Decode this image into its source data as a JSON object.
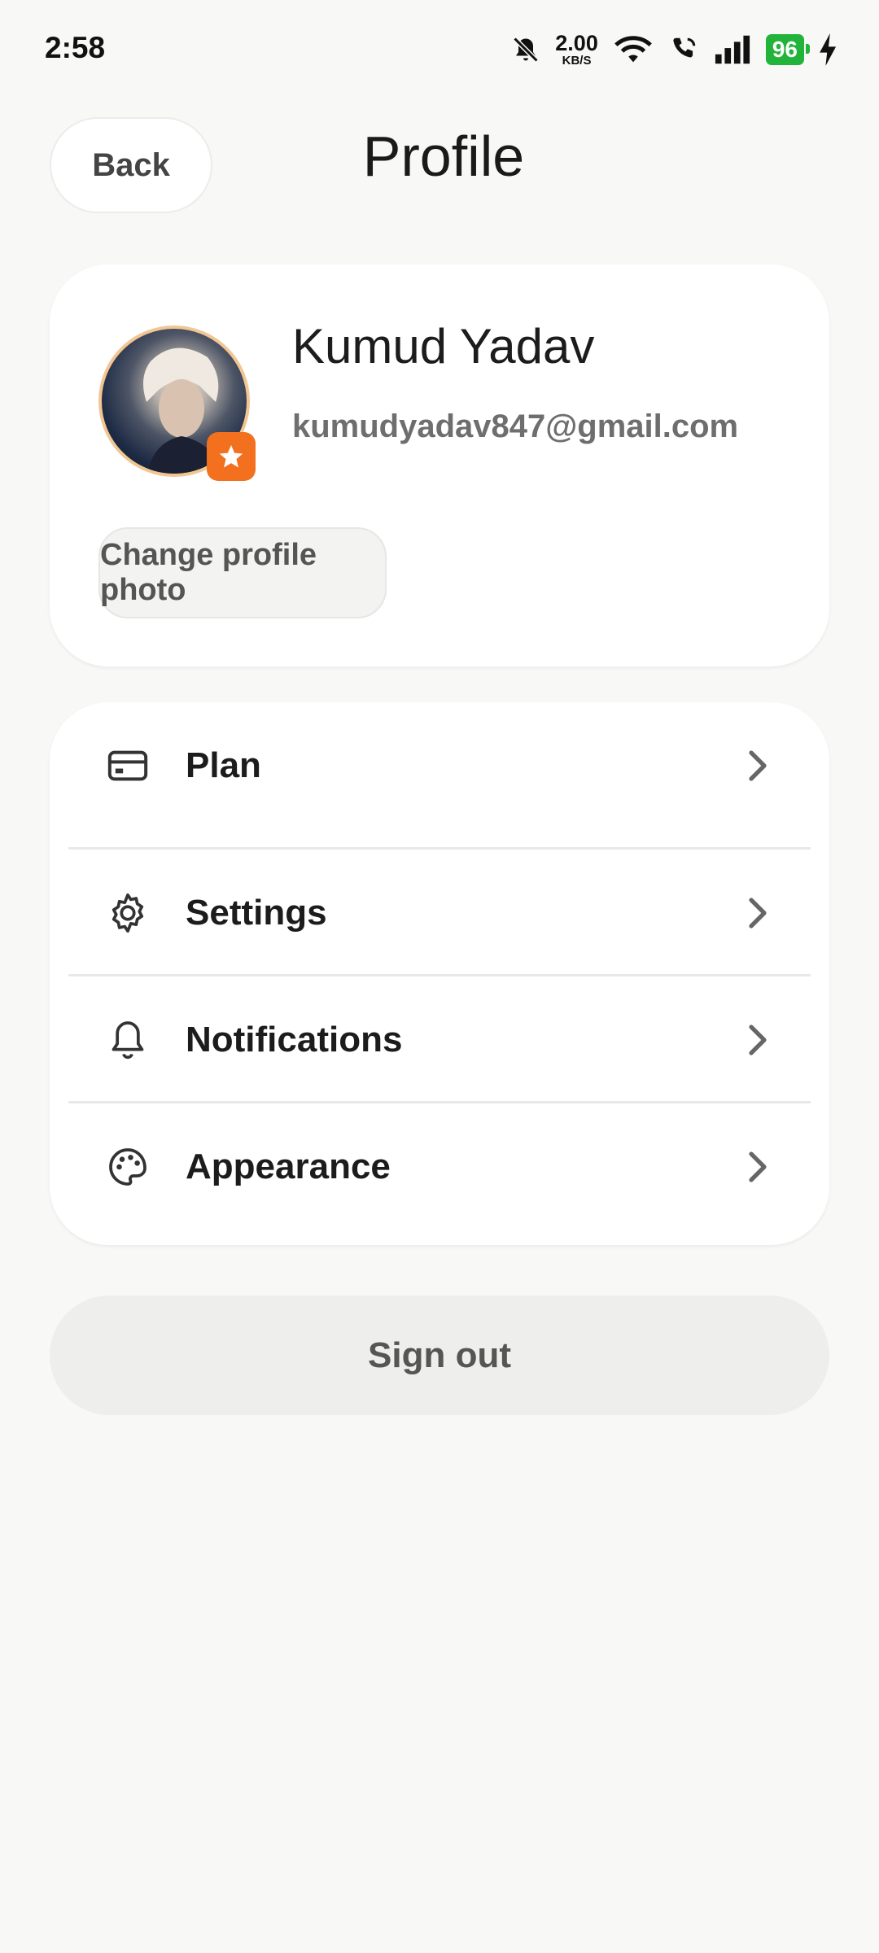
{
  "status_bar": {
    "time": "2:58",
    "net_speed_value": "2.00",
    "net_speed_unit": "KB/S",
    "battery": "96"
  },
  "header": {
    "back_label": "Back",
    "title": "Profile"
  },
  "profile": {
    "name": "Kumud Yadav",
    "email": "kumudyadav847@gmail.com",
    "change_photo_label": "Change profile photo",
    "badge_icon": "star-icon"
  },
  "menu": {
    "items": [
      {
        "label": "Plan",
        "icon": "credit-card-icon"
      },
      {
        "label": "Settings",
        "icon": "gear-icon"
      },
      {
        "label": "Notifications",
        "icon": "bell-icon"
      },
      {
        "label": "Appearance",
        "icon": "palette-icon"
      }
    ]
  },
  "sign_out_label": "Sign out",
  "colors": {
    "accent_badge": "#f2701e",
    "battery": "#22b33a",
    "background": "#f8f8f7"
  }
}
